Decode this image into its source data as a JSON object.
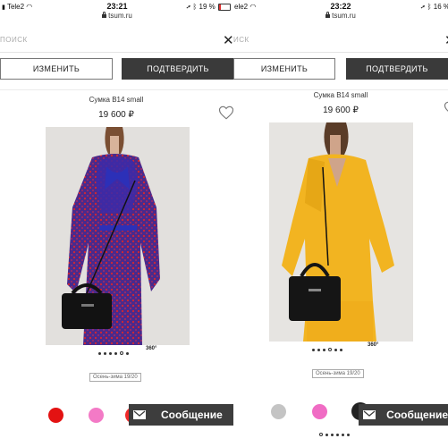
{
  "left": {
    "status": {
      "carrier": "Tele2",
      "time": "23:21",
      "url": "tsum.ru",
      "battery_text": "19 %",
      "battery_level": 0.19
    },
    "search_placeholder": "ПОИСК",
    "buttons": {
      "change": "ИЗМЕНИТЬ",
      "confirm": "ПОДТВЕРДИТЬ"
    },
    "product": {
      "name": "Сумка B14 small",
      "price": "19 600 ₽",
      "season": "Осень-зима 19/20",
      "view360": "360°"
    },
    "swatch_colors": [
      "#e31212",
      "#f37ac6",
      "#f12a2a"
    ],
    "message_label": "Сообщение"
  },
  "right": {
    "status": {
      "carrier": "ele2",
      "time": "23:22",
      "url": "tsum.ru",
      "battery_text": "16 %"
    },
    "search_placeholder": "ИСК",
    "buttons": {
      "change": "ИЗМЕНИТЬ",
      "confirm": "ПОДТВЕРДИТЬ"
    },
    "product": {
      "name": "Сумка B14 small",
      "price": "19 600 ₽",
      "season": "Осень-зима 19/20",
      "view360": "360°"
    },
    "swatch_colors": [
      "#c4c4c4",
      "#f06cc4",
      "#222222"
    ],
    "message_label": "Сообщение"
  }
}
